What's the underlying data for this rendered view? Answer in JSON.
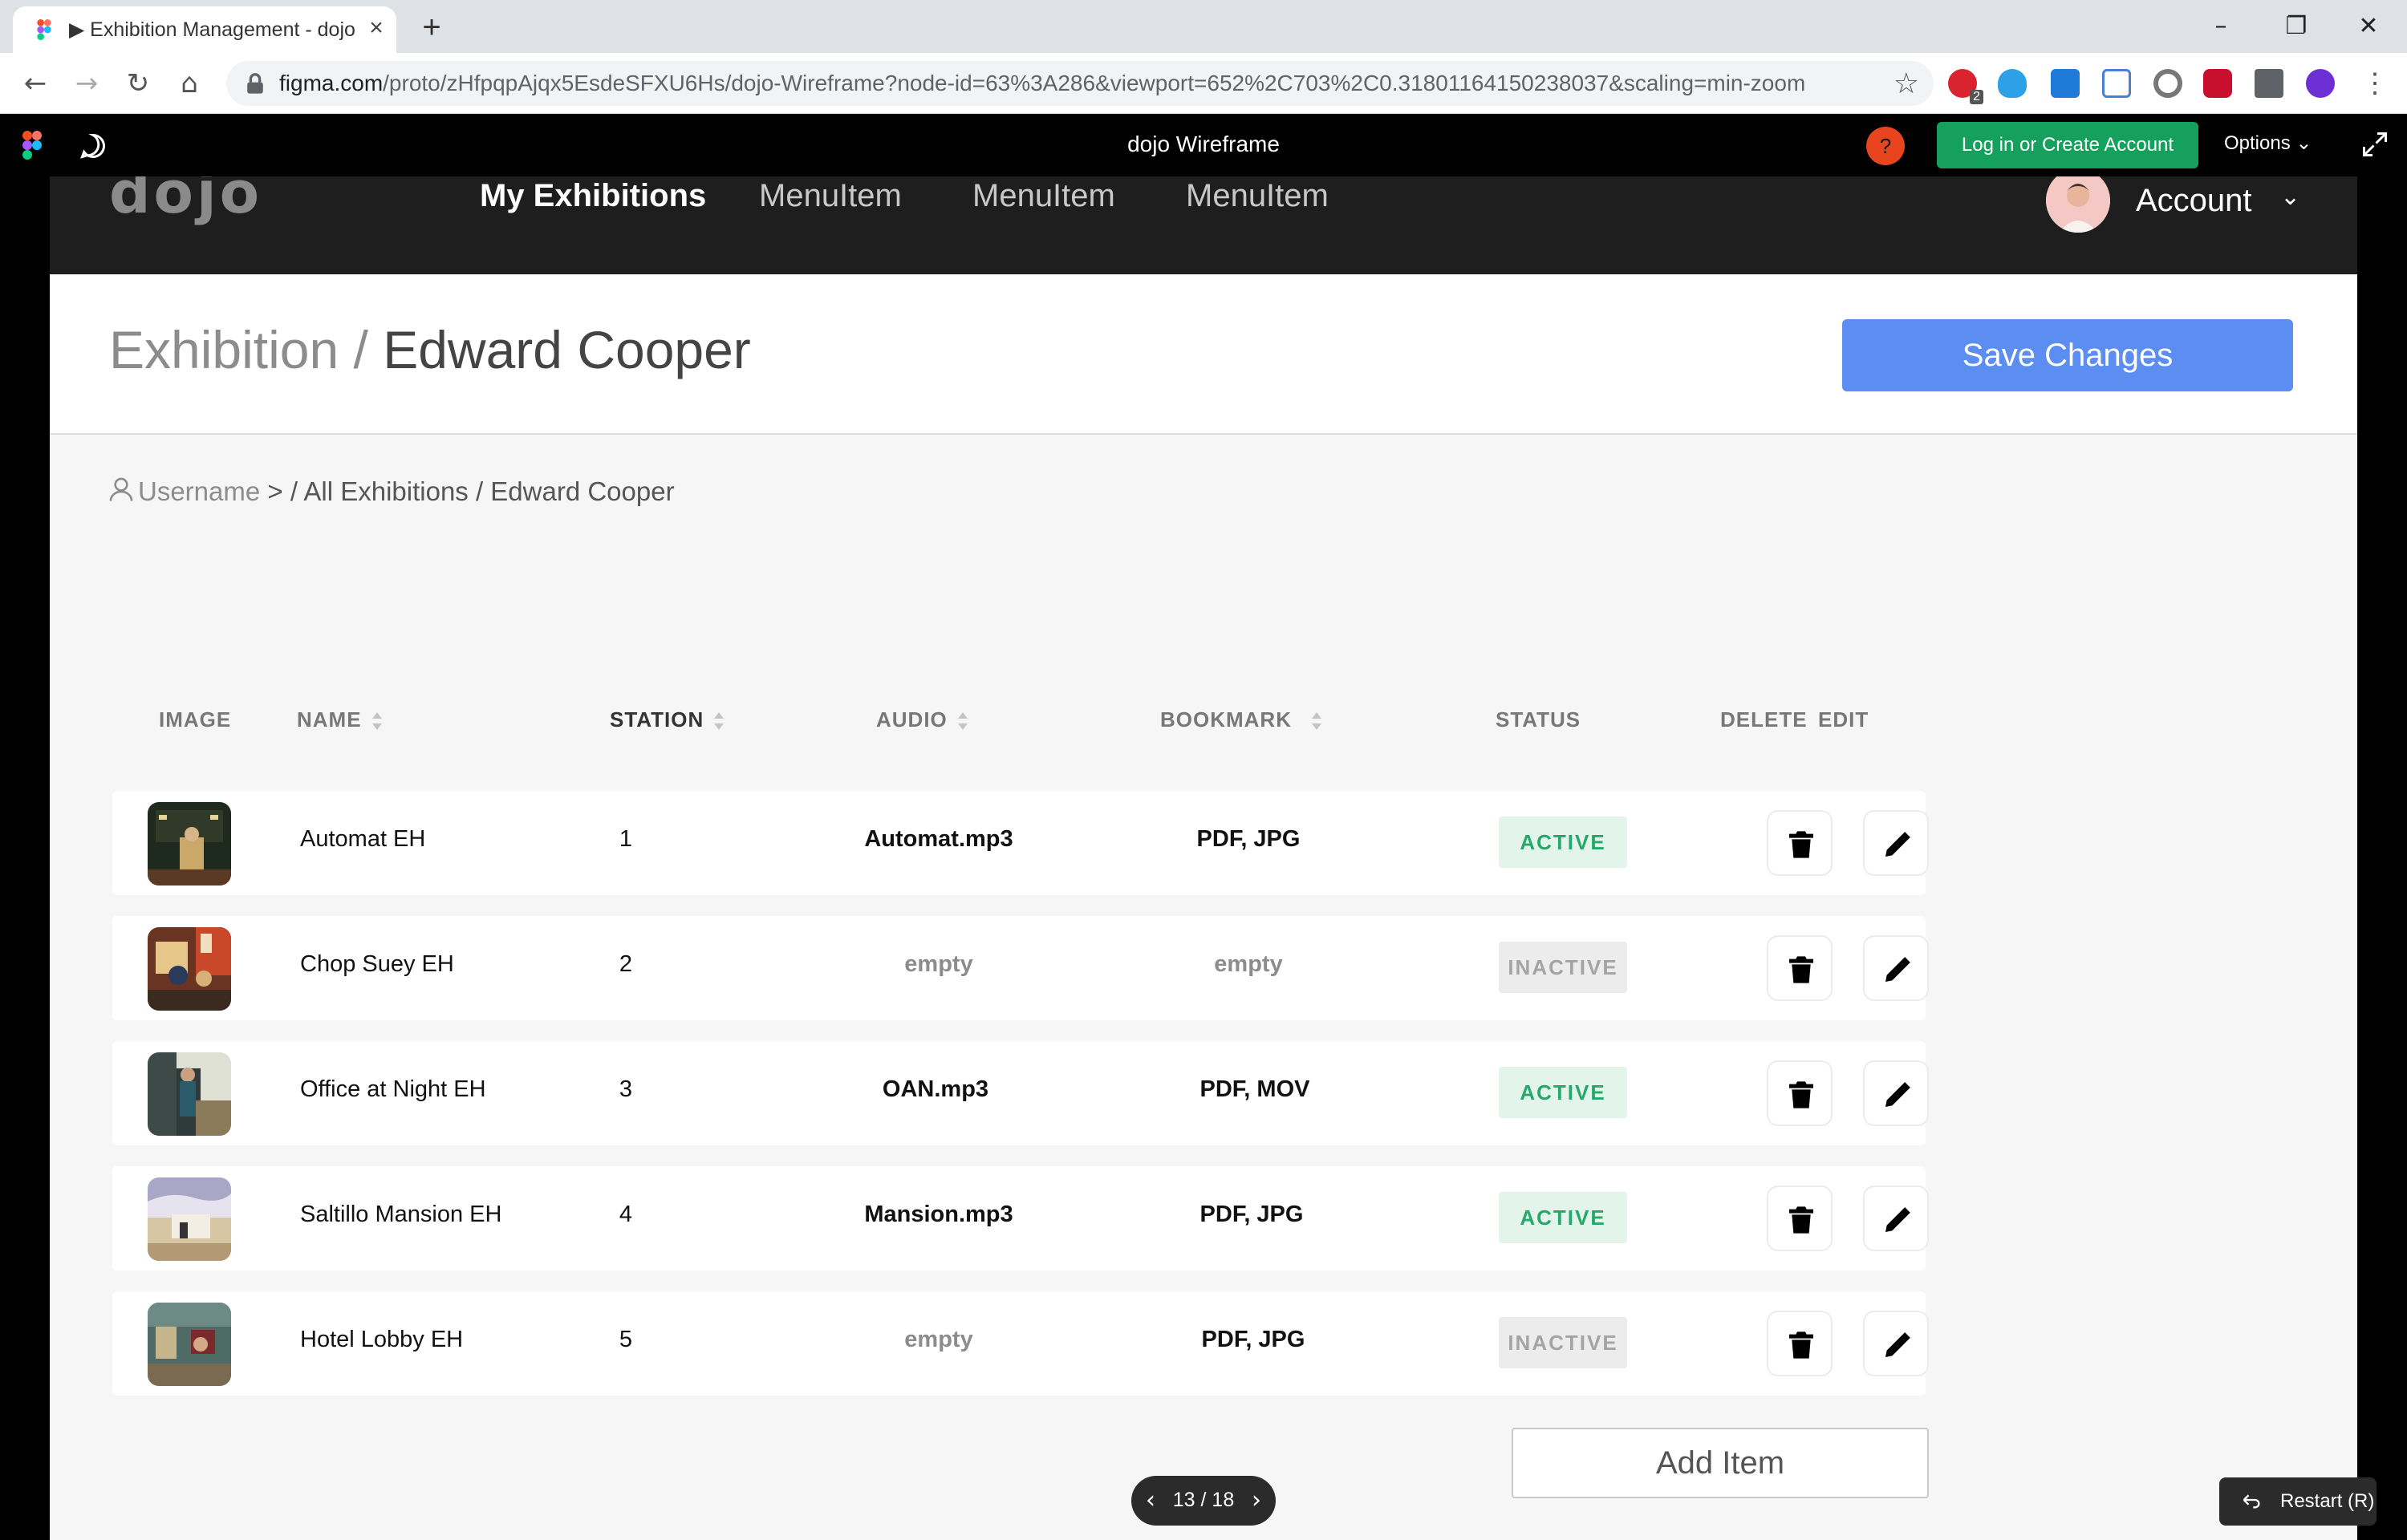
{
  "browser": {
    "tab_title": "Exhibition Management - dojo",
    "url_host": "figma.com",
    "url_rest": "/proto/zHfpqpAjqx5EsdeSFXU6Hs/dojo-Wireframe?node-id=63%3A286&viewport=652%2C703%2C0.31801164150238037&scaling=min-zoom",
    "extension_badge": "2"
  },
  "figma": {
    "title": "dojo Wireframe",
    "help": "?",
    "login_label": "Log in or Create Account",
    "options_label": "Options",
    "pager": "13 / 18",
    "restart_label": "Restart (R)"
  },
  "app": {
    "logo": "dojo",
    "nav": [
      "My Exhibitions",
      "MenuItem",
      "MenuItem",
      "MenuItem"
    ],
    "account_label": "Account",
    "header": {
      "crumb_section": "Exhibition /",
      "crumb_title": "Edward Cooper",
      "save_label": "Save Changes"
    },
    "breadcrumb": {
      "user": "Username",
      "path": "> / All Exhibitions / Edward Cooper"
    },
    "table": {
      "headers": {
        "image": "IMAGE",
        "name": "NAME",
        "station": "STATION",
        "audio": "AUDIO",
        "bookmark": "BOOKMARK",
        "status": "STATUS",
        "delete": "DELETE",
        "edit": "EDIT"
      },
      "rows": [
        {
          "name": "Automat EH",
          "station": "1",
          "audio": "Automat.mp3",
          "bookmark": "PDF, JPG",
          "status": "ACTIVE"
        },
        {
          "name": "Chop Suey EH",
          "station": "2",
          "audio": "empty",
          "bookmark": "empty",
          "status": "INACTIVE"
        },
        {
          "name": "Office at Night EH",
          "station": "3",
          "audio": "OAN.mp3",
          "bookmark": "PDF, MOV",
          "status": "ACTIVE"
        },
        {
          "name": "Saltillo Mansion EH",
          "station": "4",
          "audio": "Mansion.mp3",
          "bookmark": "PDF, JPG",
          "status": "ACTIVE"
        },
        {
          "name": "Hotel Lobby EH",
          "station": "5",
          "audio": "empty",
          "bookmark": "PDF, JPG",
          "status": "INACTIVE"
        }
      ]
    },
    "add_item_label": "Add Item"
  }
}
